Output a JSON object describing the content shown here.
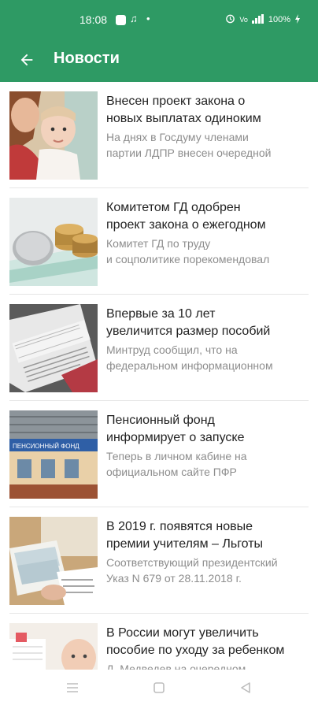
{
  "status_bar": {
    "time": "18:08",
    "battery": "100%",
    "icons": [
      "square-notification-icon",
      "music-icon",
      "dot-icon",
      "alarm-icon",
      "volte-icon",
      "signal-icon",
      "battery-icon"
    ]
  },
  "app_bar": {
    "title": "Новости",
    "back_icon": "arrow-left-icon"
  },
  "news": [
    {
      "title_lines": [
        "Внесен проект закона о",
        "новых выплатах одиноким"
      ],
      "desc_lines": [
        "На днях в Госдуму членами",
        "партии ЛДПР внесен очередной"
      ],
      "thumb": "mother-baby"
    },
    {
      "title_lines": [
        "Комитетом ГД одобрен",
        "проект закона о ежегодном"
      ],
      "desc_lines": [
        "Комитет ГД по труду",
        "и соцполитике порекомендовал"
      ],
      "thumb": "coins"
    },
    {
      "title_lines": [
        "Впервые за 10 лет",
        "увеличится размер пособий"
      ],
      "desc_lines": [
        "Минтруд сообщил, что на",
        "федеральном информационном"
      ],
      "thumb": "newspaper-rabota"
    },
    {
      "title_lines": [
        "Пенсионный фонд",
        "информирует о запуске"
      ],
      "desc_lines": [
        "Теперь в личном кабине на",
        "официальном сайте ПФР"
      ],
      "thumb": "pension-fund-building",
      "thumb_text": "ПЕНСИОННЫЙ ФОНД"
    },
    {
      "title_lines": [
        "В 2019 г. появятся новые",
        "премии учителям  – Льготы"
      ],
      "desc_lines": [
        "Соответствующий президентский",
        "Указ N 679 от 28.11.2018 г."
      ],
      "thumb": "money-documents"
    },
    {
      "title_lines": [
        "В России могут увеличить",
        "пособие по уходу за ребенком"
      ],
      "desc_lines": [
        "Д. Медведев на очередном"
      ],
      "thumb": "baby-notebook"
    }
  ],
  "nav_bar": {
    "items": [
      "menu-icon",
      "home-icon",
      "back-triangle-icon"
    ]
  },
  "colors": {
    "primary": "#2e9a64",
    "title_text": "#222222",
    "desc_text": "#8d8d8d"
  }
}
